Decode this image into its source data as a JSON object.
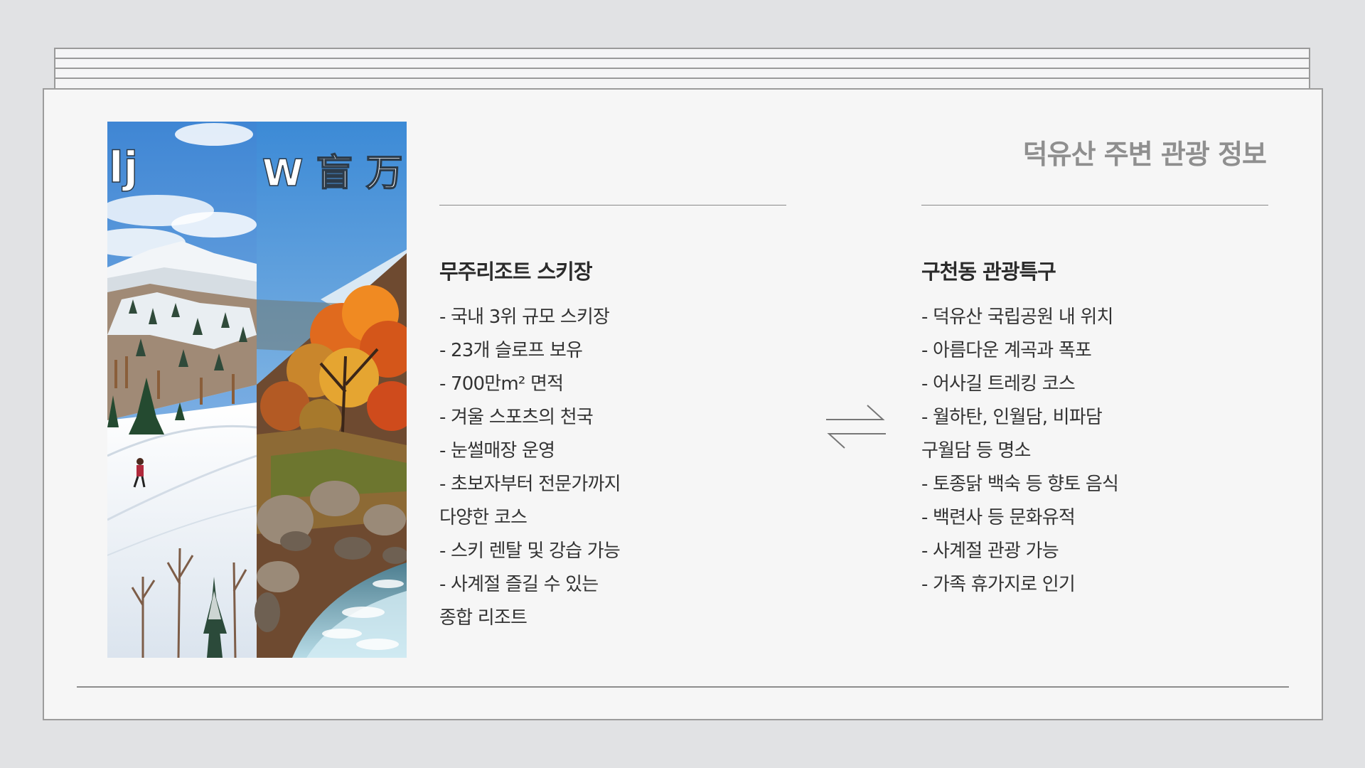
{
  "title": "덕유산 주변 관광 정보",
  "photo_overlay_text": {
    "left": "lj",
    "right": "W 盲 万"
  },
  "left_section": {
    "heading": "무주리조트 스키장",
    "items": [
      "- 국내 3위 규모 스키장",
      "- 23개 슬로프 보유",
      "- 700만m² 면적",
      "- 겨울 스포츠의 천국",
      "- 눈썰매장 운영",
      "- 초보자부터 전문가까지",
      "다양한 코스",
      "- 스키 렌탈 및 강습 가능",
      "- 사계절 즐길 수 있는",
      "종합 리조트"
    ]
  },
  "right_section": {
    "heading": "구천동 관광특구",
    "items": [
      "- 덕유산 국립공원 내 위치",
      "- 아름다운 계곡과 폭포",
      "- 어사길 트레킹 코스",
      "- 월하탄, 인월담, 비파담",
      "구월담 등 명소",
      "- 토종닭 백숙 등 향토 음식",
      "- 백련사 등 문화유적",
      "- 사계절 관광 가능",
      "- 가족 휴가지로 인기"
    ]
  },
  "icons": {
    "swap": "swap-arrows-icon"
  },
  "colors": {
    "background": "#e1e2e4",
    "card": "#f6f6f6",
    "title": "#8f8f8f",
    "text": "#333333"
  }
}
